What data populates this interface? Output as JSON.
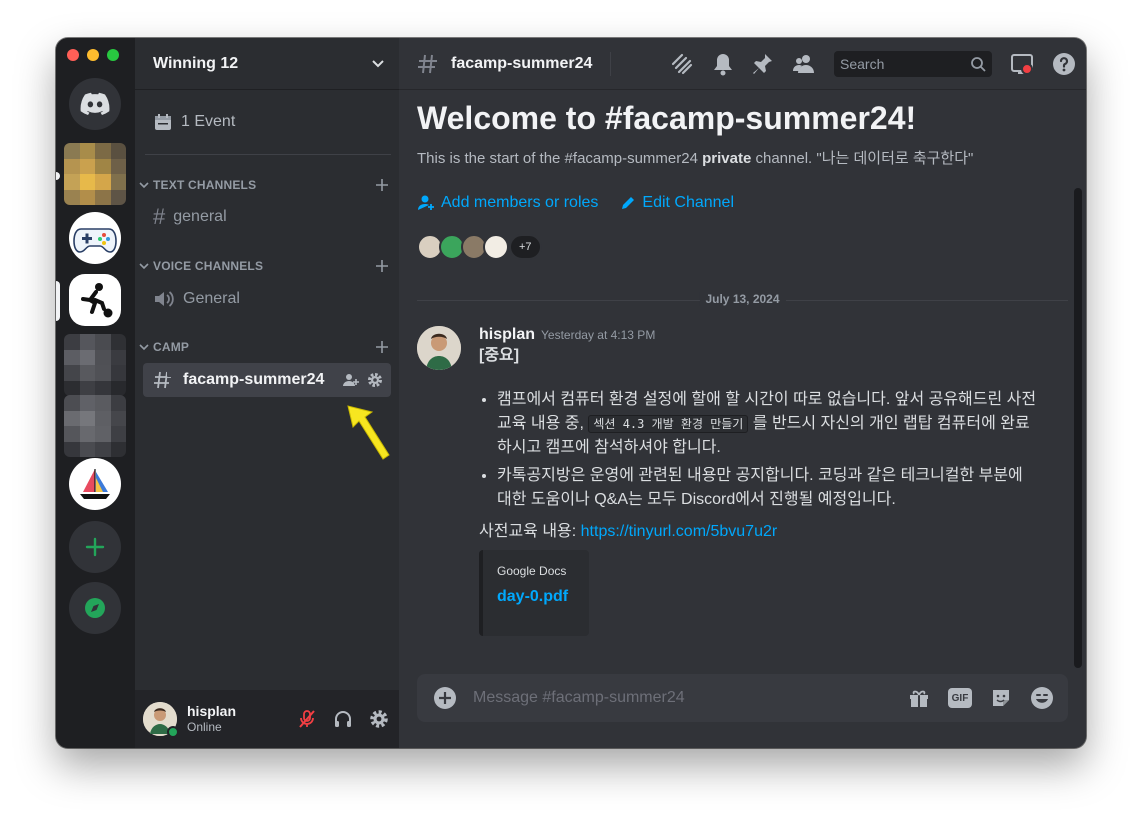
{
  "window": {
    "traffic_colors": [
      "#ff5f57",
      "#febc2e",
      "#28c840"
    ]
  },
  "rail": {
    "icons": [
      "discord-home-icon",
      "pixel-server",
      "gamepad-server",
      "soccer-server",
      "pixel-server",
      "pixel-server",
      "sailboat-server",
      "add-server-icon",
      "explore-icon"
    ]
  },
  "sidebar": {
    "guild_name": "Winning 12",
    "event_label": "1 Event",
    "categories": [
      {
        "name": "TEXT CHANNELS",
        "channels": [
          "general"
        ]
      },
      {
        "name": "VOICE CHANNELS",
        "channels": [
          "General"
        ]
      },
      {
        "name": "CAMP",
        "channels": [
          "facamp-summer24"
        ]
      }
    ]
  },
  "user": {
    "name": "hisplan",
    "status": "Online"
  },
  "topbar": {
    "channel": "facamp-summer24",
    "search_placeholder": "Search"
  },
  "intro": {
    "title": "Welcome to #facamp-summer24!",
    "desc_pre": "This is the start of the #facamp-summer24 ",
    "desc_bold": "private",
    "desc_post": " channel. \"나는 데이터로 축구한다\"",
    "add_members": "Add members or roles",
    "edit_channel": "Edit Channel",
    "more_members": "+7"
  },
  "divider_date": "July 13, 2024",
  "message": {
    "author": "hisplan",
    "timestamp": "Yesterday at 4:13 PM",
    "heading": "[중요]",
    "bullet1_a": "캠프에서 컴퓨터 환경 설정에 할애 할 시간이 따로 없습니다. 앞서 공유해드린 사전교육 내용 중, ",
    "bullet1_code": "섹션 4.3 개발 환경 만들기",
    "bullet1_b": " 를 반드시 자신의 개인 랩탑 컴퓨터에 완료하시고 캠프에 참석하셔야 합니다.",
    "bullet2": "카톡공지방은 운영에 관련된 내용만 공지합니다. 코딩과 같은 테크니컬한 부분에 대한 도움이나 Q&A는 모두 Discord에서 진행될 예정입니다.",
    "link_label": "사전교육 내용: ",
    "link_url": "https://tinyurl.com/5bvu7u2r",
    "embed_provider": "Google Docs",
    "embed_title": "day-0.pdf"
  },
  "composer": {
    "placeholder": "Message #facamp-summer24",
    "gif_label": "GIF"
  },
  "colors": {
    "accent_link": "#00a8fc",
    "online": "#23a55a",
    "add_server": "#23a55a",
    "arrow": "#f7e620"
  }
}
